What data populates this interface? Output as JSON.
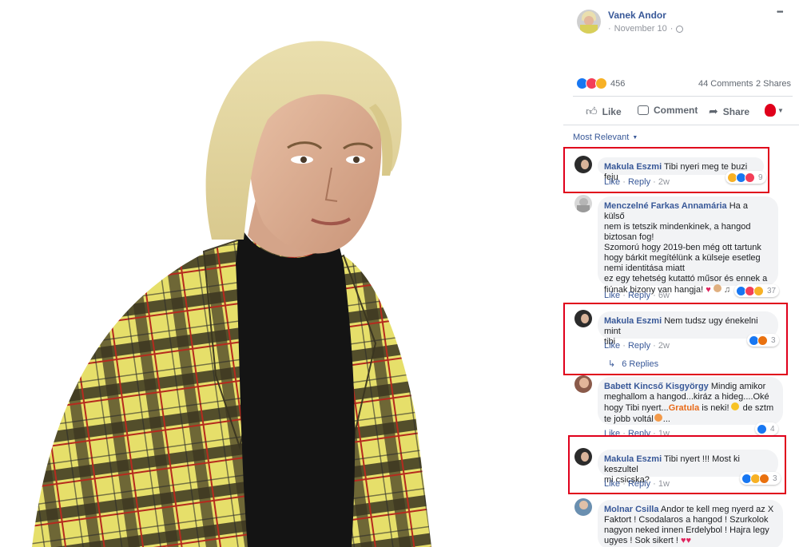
{
  "post": {
    "author": "Vanek Andor",
    "date": "November 10",
    "date_sep": "·",
    "more": "•••",
    "reaction_count": "456",
    "comments_count": "44 Comments",
    "shares_count": "2 Shares",
    "like_label": "Like",
    "comment_label": "Comment",
    "share_label": "Share",
    "sort_label": "Most Relevant"
  },
  "comments": [
    {
      "name": "Makula Eszmi",
      "text": "Tibi nyeri meg te buzi feju",
      "like": "Like",
      "reply": "Reply",
      "time": "2w",
      "reactions": "9"
    },
    {
      "name": "Menczelné Farkas Annamária",
      "text_lines": [
        "Ha a külső",
        "nem is tetszik mindenkinek, a hangod",
        "biztosan fog!",
        "Szomorú hogy 2019-ben még ott tartunk",
        "hogy bárkit megítélünk a külseje esetleg",
        "nemi identitása miatt",
        "ez egy tehetség kutattó műsor és ennek a",
        "fiúnak bizony van hangja!"
      ],
      "like": "Like",
      "reply": "Reply",
      "time": "6w",
      "reactions": "37"
    },
    {
      "name": "Makula Eszmi",
      "text_lines": [
        "Nem tudsz ugy énekelni mint",
        "tibi"
      ],
      "like": "Like",
      "reply": "Reply",
      "time": "2w",
      "reactions": "3",
      "replies": "6 Replies"
    },
    {
      "name": "Babett Kincső Kisgyörgy",
      "text_lines": [
        "Mindig amikor",
        "meghallom a hangod...kiráz a hideg....Oké",
        "hogy Tibi nyert...",
        "is neki!",
        "de sztm",
        "te jobb voltál",
        "..."
      ],
      "highlight": "Gratula",
      "like": "Like",
      "reply": "Reply",
      "time": "1w",
      "reactions": "4"
    },
    {
      "name": "Makula Eszmi",
      "text_lines": [
        "Tibi nyert !!! Most ki keszultel",
        "mi csicska?"
      ],
      "like": "Like",
      "reply": "Reply",
      "time": "1w",
      "reactions": "3"
    },
    {
      "name": "Molnar Csilla",
      "text_lines": [
        "Andor te kell meg nyerd az X",
        "Faktort ! Csodalaros a hangod ! Szurkolok",
        "nagyon neked innen Erdelybol ! Hajra legy",
        "ugyes ! Sok sikert !"
      ]
    }
  ],
  "colors": {
    "accent": "#385898",
    "highlight_box": "#e0001b"
  }
}
